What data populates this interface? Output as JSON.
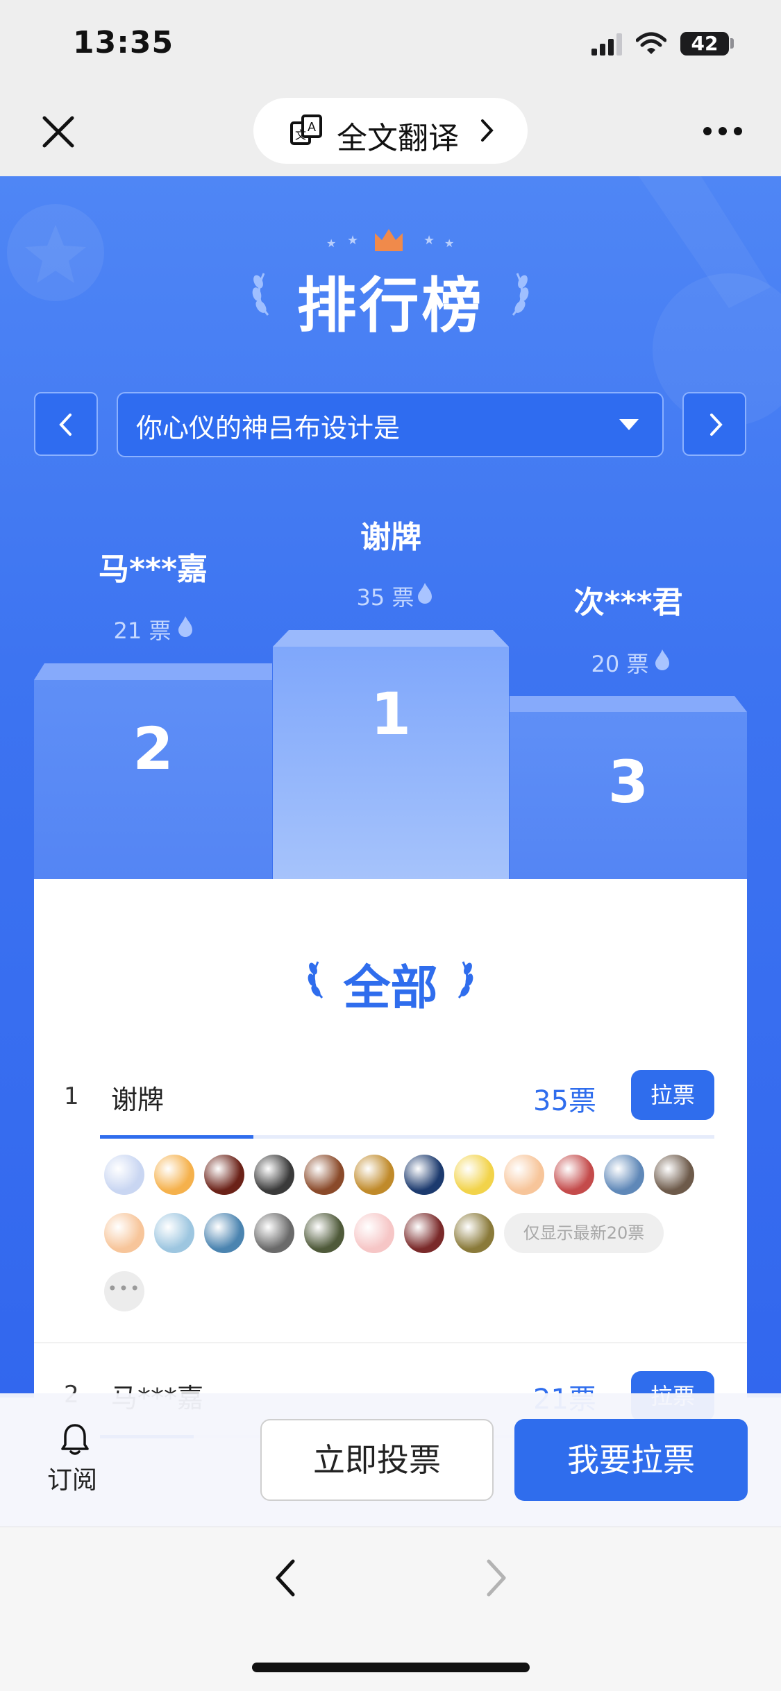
{
  "status_bar": {
    "time": "13:35",
    "battery": "42"
  },
  "nav_bar": {
    "translate_label": "全文翻译"
  },
  "page": {
    "title": "排行榜"
  },
  "question_select": {
    "value": "你心仪的神吕布设计是"
  },
  "podium": [
    {
      "rank": "2",
      "name": "马***嘉",
      "votes": "21 票"
    },
    {
      "rank": "1",
      "name": "谢牌",
      "votes": "35 票"
    },
    {
      "rank": "3",
      "name": "次***君",
      "votes": "20 票"
    }
  ],
  "section": {
    "title": "全部"
  },
  "ranking": [
    {
      "rank": "1",
      "name": "谢牌",
      "votes": "35票",
      "button": "拉票",
      "progress": 0.25
    },
    {
      "rank": "2",
      "name": "马***嘉",
      "votes": "21票",
      "button": "拉票"
    }
  ],
  "voters": {
    "note": "仅显示最新20票",
    "more": "•••"
  },
  "action_bar": {
    "subscribe_label": "订阅",
    "vote_now_label": "立即投票",
    "canvass_label": "我要拉票"
  },
  "colors": {
    "primary": "#2f6ded",
    "hero_bg": "#3d74f1",
    "podium_gold": "#f08a4b"
  },
  "icons": [
    "close-icon",
    "translate-icon",
    "chevron-right-icon",
    "more-icon",
    "crown-icon",
    "laurel-icon",
    "chevron-left-icon",
    "dropdown-arrow-icon",
    "flame-icon",
    "bell-icon",
    "back-arrow-icon",
    "forward-arrow-icon"
  ]
}
